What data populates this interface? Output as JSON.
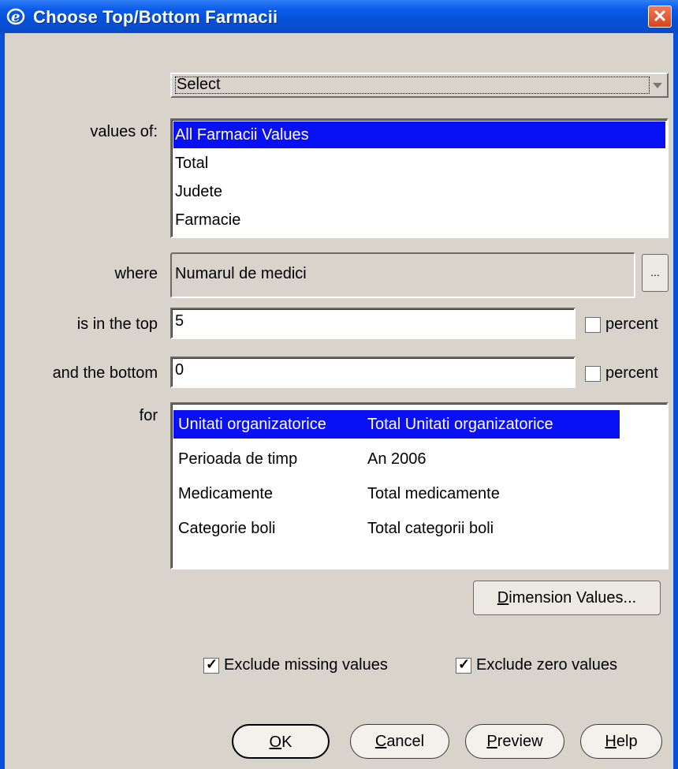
{
  "window": {
    "title": "Choose Top/Bottom Farmacii",
    "close_label": "✕"
  },
  "combo": {
    "value": "Select"
  },
  "values_of": {
    "label": "values of:",
    "items": [
      "All Farmacii Values",
      "Total",
      "Judete",
      "Farmacie"
    ],
    "selected_index": 0
  },
  "where": {
    "label": "where",
    "value": "Numarul de medici",
    "button_label": "..."
  },
  "top": {
    "label": "is in the top",
    "value": "5",
    "percent_label": "percent",
    "percent_checked": false
  },
  "bottom": {
    "label": "and the bottom",
    "value": "0",
    "percent_label": "percent",
    "percent_checked": false
  },
  "for": {
    "label": "for",
    "rows": [
      {
        "dimension": "Unitati organizatorice",
        "value": "Total Unitati organizatorice"
      },
      {
        "dimension": "Perioada de timp",
        "value": "An 2006"
      },
      {
        "dimension": "Medicamente",
        "value": "Total medicamente"
      },
      {
        "dimension": "Categorie boli",
        "value": "Total categorii boli"
      }
    ],
    "selected_index": 0
  },
  "dimension_values_button": {
    "mnemonic": "D",
    "rest": "imension Values..."
  },
  "options": {
    "exclude_missing": {
      "label": "Exclude missing values",
      "checked": true
    },
    "exclude_zero": {
      "label": "Exclude zero values",
      "checked": true
    }
  },
  "buttons": {
    "ok": {
      "mnemonic": "O",
      "rest": "K"
    },
    "cancel": {
      "mnemonic": "C",
      "rest": "ancel"
    },
    "preview": {
      "mnemonic": "P",
      "rest": "review"
    },
    "help": {
      "mnemonic": "H",
      "rest": "elp"
    }
  },
  "colors": {
    "title_bar": "#0a5ae8",
    "selection": "#0a10f5",
    "dialog_bg": "#d8d4cc",
    "close": "#d8421c"
  }
}
